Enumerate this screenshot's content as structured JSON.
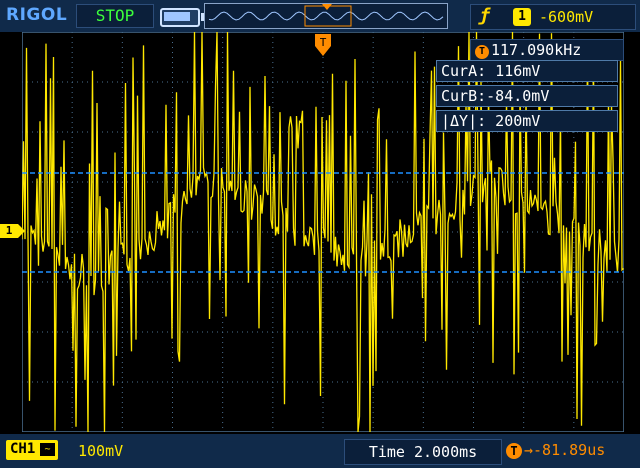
{
  "topbar": {
    "brand": "RIGOL",
    "status": "STOP"
  },
  "trigger": {
    "channel": "1",
    "level": "-600mV",
    "type_icon": "edge-trigger-icon",
    "position_icon": "trigger-position-icon"
  },
  "measure": {
    "frequency": "117.090kHz",
    "freq_icon": "T"
  },
  "cursors": {
    "cur_a": "CurA: 116mV",
    "cur_b": "CurB:-84.0mV",
    "delta_y": "|ΔY|: 200mV"
  },
  "channel1": {
    "label": "CH1",
    "coupling": "~",
    "scale": "100mV",
    "marker": "1"
  },
  "timebase": {
    "text": "Time 2.000ms"
  },
  "delay": {
    "icon": "T",
    "value": "→-81.89us"
  },
  "colors": {
    "trace": "#ffe800",
    "cursor": "#1e90ff",
    "grid": "#4a6f8f",
    "trigger": "#ff8c00"
  },
  "waveform": {
    "shape": "noisy-triangle",
    "triangle_peaks_ms": [
      3.8,
      13.0
    ],
    "triangle_troughs_ms": [
      -1.5,
      8.6,
      17.6
    ]
  }
}
